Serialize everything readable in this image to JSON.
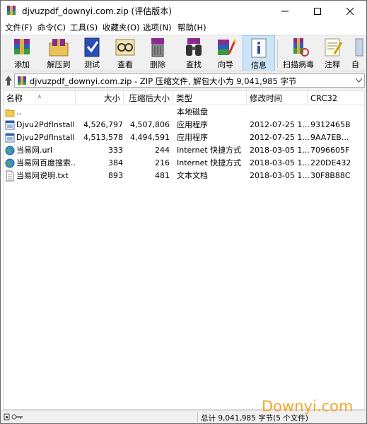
{
  "window": {
    "title": "djvuzpdf_downyi.com.zip (评估版本)"
  },
  "menu": [
    "文件(F)",
    "命令(C)",
    "工具(S)",
    "收藏夹(O)",
    "选项(N)",
    "帮助(H)"
  ],
  "toolbar": {
    "add": "添加",
    "extract": "解压到",
    "test": "测试",
    "view": "查看",
    "delete": "删除",
    "find": "查找",
    "wizard": "向导",
    "info": "信息",
    "scan": "扫描病毒",
    "comment": "注释",
    "more": "自"
  },
  "address": {
    "path": "djvuzpdf_downyi.com.zip - ZIP 压缩文件, 解包大小为 9,041,985 字节"
  },
  "columns": {
    "name": "名称",
    "size": "大小",
    "packed": "压缩后大小",
    "type": "类型",
    "modified": "修改时间",
    "crc": "CRC32"
  },
  "files": [
    {
      "name": "..",
      "size": "",
      "packed": "",
      "type": "本地磁盘",
      "modified": "",
      "crc": "",
      "icon": "folder-icon"
    },
    {
      "name": "Djvu2PdfInstall...",
      "size": "4,526,797",
      "packed": "4,507,806",
      "type": "应用程序",
      "modified": "2012-07-25 1...",
      "crc": "9312465B",
      "icon": "exe-icon"
    },
    {
      "name": "Djvu2PdfInstall...",
      "size": "4,513,578",
      "packed": "4,494,591",
      "type": "应用程序",
      "modified": "2012-07-25 1...",
      "crc": "9AA7EB...",
      "icon": "exe-icon"
    },
    {
      "name": "当易网.url",
      "size": "333",
      "packed": "244",
      "type": "Internet 快捷方式",
      "modified": "2018-03-05 1...",
      "crc": "7096605F",
      "icon": "globe-icon"
    },
    {
      "name": "当易网百度搜索...",
      "size": "384",
      "packed": "216",
      "type": "Internet 快捷方式",
      "modified": "2018-03-05 1...",
      "crc": "220DE432",
      "icon": "globe-icon"
    },
    {
      "name": "当易网说明.txt",
      "size": "893",
      "packed": "481",
      "type": "文本文档",
      "modified": "2018-03-05 1...",
      "crc": "30F8B88C",
      "icon": "text-file-icon"
    }
  ],
  "status": {
    "text": "总计 9,041,985 字节(5 个文件)"
  },
  "watermark": "Downyi.com"
}
